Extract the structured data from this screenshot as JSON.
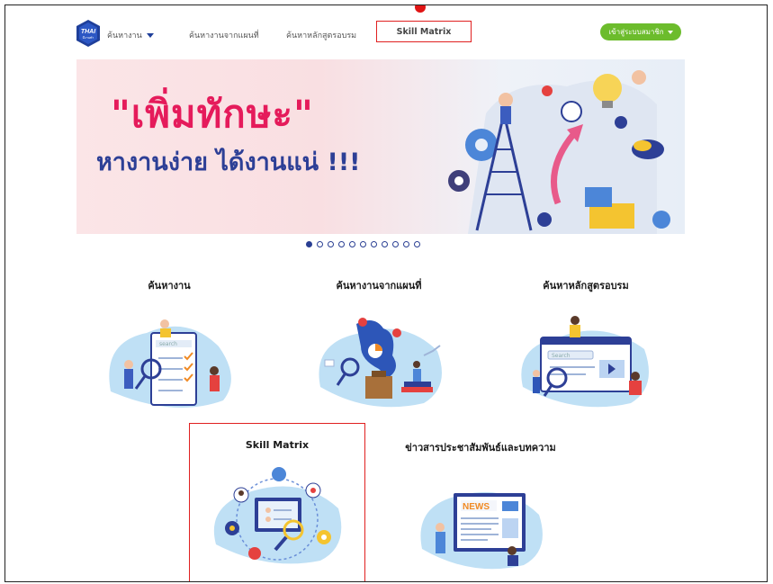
{
  "nav": {
    "logo_text": "THAI",
    "logo_subtext": "มีงานทำ",
    "items": [
      "ค้นหางาน",
      "ค้นหางานจากแผนที่",
      "ค้นหาหลักสูตรอบรม"
    ],
    "skill_matrix": "Skill Matrix",
    "member_button": "เข้าสู่ระบบสมาชิก",
    "accent": "#1f3f9a",
    "member_color": "#6cbc2c"
  },
  "banner": {
    "headline": "\"เพิ่มทักษะ\"",
    "subline": "หางานง่าย ได้งานแน่ !!!",
    "headline_color": "#e51b5b",
    "subline_color": "#2d3f96"
  },
  "carousel": {
    "total": 11,
    "active_index": 0
  },
  "cards": [
    {
      "title": "ค้นหางาน",
      "art_text": "search",
      "icon": "job-search-illustration"
    },
    {
      "title": "ค้นหางานจากแผนที่",
      "icon": "map-search-illustration"
    },
    {
      "title": "ค้นหาหลักสูตรอบรม",
      "art_text": "Search",
      "icon": "course-search-illustration"
    },
    {
      "title": "Skill Matrix",
      "icon": "skill-matrix-illustration"
    },
    {
      "title": "ข่าวสารประชาสัมพันธ์และบทความ",
      "art_text": "NEWS",
      "icon": "news-illustration"
    }
  ]
}
